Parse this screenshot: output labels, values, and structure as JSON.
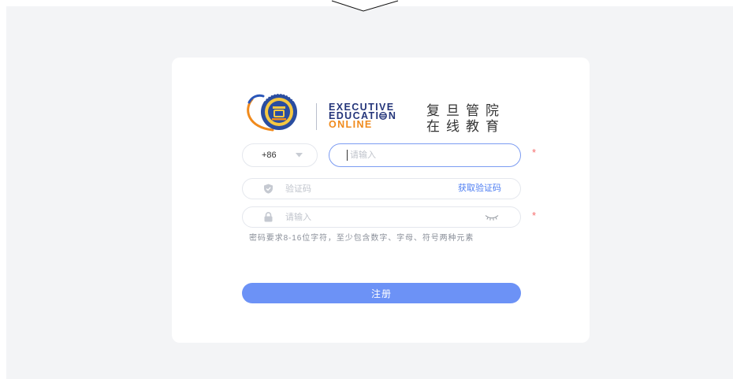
{
  "logo": {
    "line1": "EXECUTIVE",
    "line2_prefix": "EDUCATI",
    "line2_suffix": "N",
    "line3": "ONLINE",
    "cn_line1": "复旦管院",
    "cn_line2": "在线教育"
  },
  "form": {
    "country_code": "+86",
    "phone": {
      "placeholder": "请输入",
      "value": "",
      "required_mark": "*"
    },
    "code": {
      "placeholder": "验证码",
      "get_code_label": "获取验证码"
    },
    "password": {
      "placeholder": "请输入",
      "required_mark": "*"
    },
    "password_hint": "密码要求8-16位字符，至少包含数字、字母、符号两种元素",
    "submit_label": "注册"
  },
  "icons": {
    "country_dropdown": "caret-down-icon",
    "code_field": "shield-icon",
    "password_field": "lock-icon",
    "password_toggle": "eye-closed-icon",
    "brand": "school-emblem-icon"
  },
  "colors": {
    "accent": "#6c92f6",
    "link": "#4e7ef2",
    "focus_border": "#7c9cf2",
    "required": "#f56c6c",
    "brand_navy": "#24357a",
    "brand_orange": "#f08a1c",
    "page_background": "#f3f4f6"
  }
}
